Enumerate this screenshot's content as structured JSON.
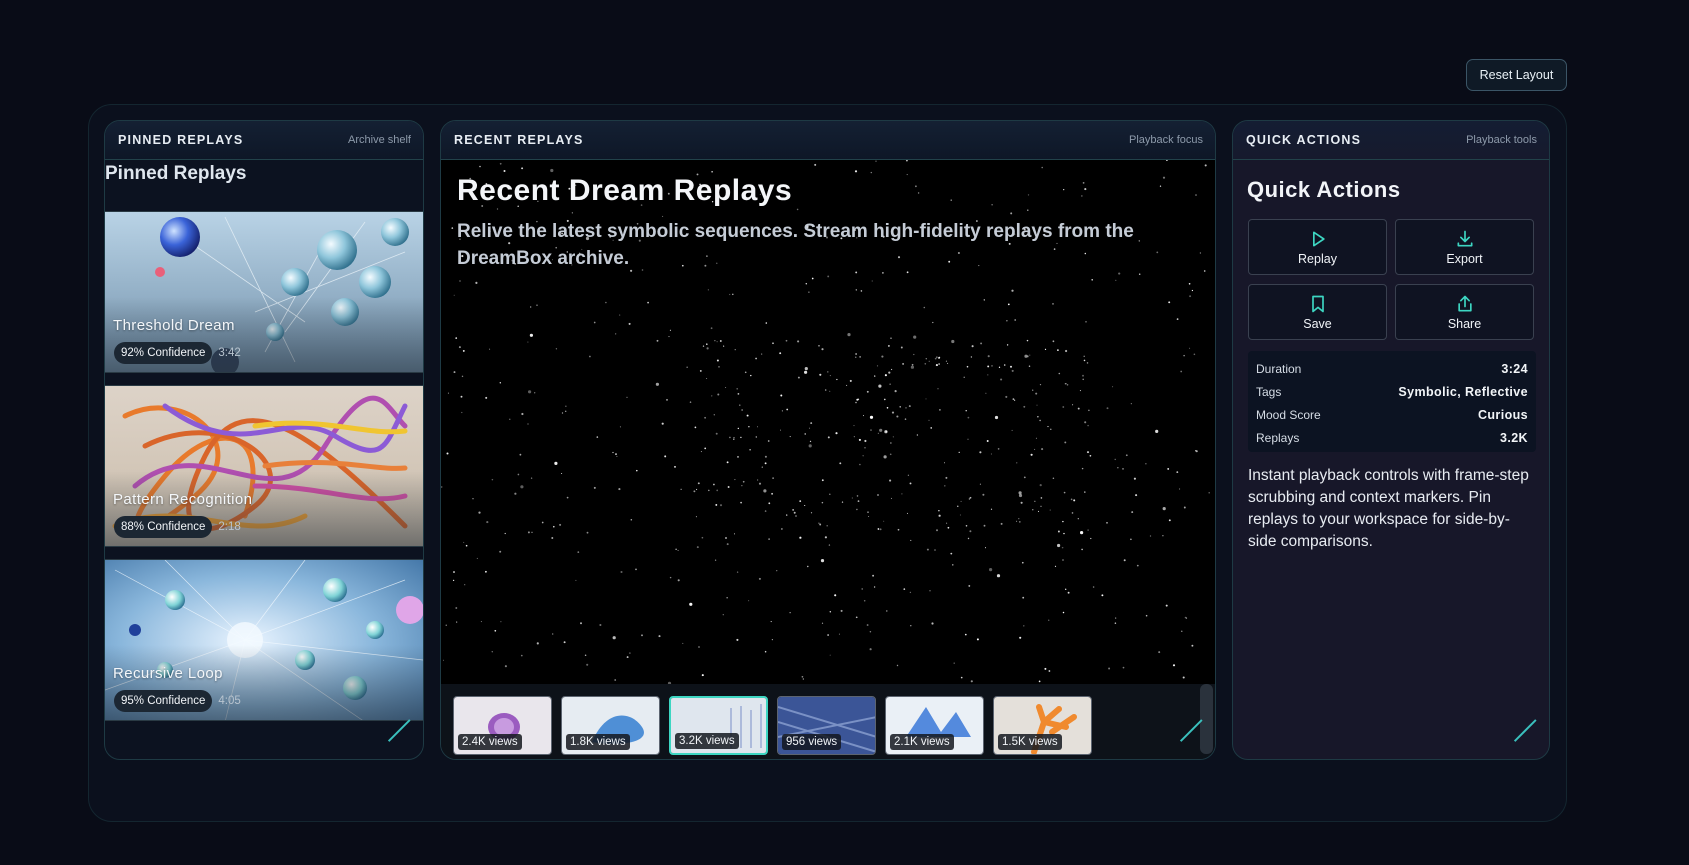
{
  "toolbar": {
    "reset_label": "Reset Layout"
  },
  "left": {
    "title": "PINNED REPLAYS",
    "subtitle": "Archive shelf",
    "heading": "Pinned Replays",
    "cards": [
      {
        "title": "Threshold Dream",
        "confidence": "92% Confidence",
        "duration": "3:42"
      },
      {
        "title": "Pattern Recognition",
        "confidence": "88% Confidence",
        "duration": "2:18"
      },
      {
        "title": "Recursive Loop",
        "confidence": "95% Confidence",
        "duration": "4:05"
      }
    ]
  },
  "center": {
    "title": "RECENT REPLAYS",
    "subtitle": "Playback focus",
    "viewer_title": "Recent Dream Replays",
    "viewer_desc": "Relive the latest symbolic sequences. Stream high-fidelity replays from the DreamBox archive.",
    "thumbnails": [
      {
        "views": "2.4K views"
      },
      {
        "views": "1.8K views"
      },
      {
        "views": "3.2K views"
      },
      {
        "views": "956 views"
      },
      {
        "views": "2.1K views"
      },
      {
        "views": "1.5K views"
      }
    ],
    "active_thumbnail_index": 2
  },
  "right": {
    "title": "QUICK ACTIONS",
    "subtitle": "Playback tools",
    "heading": "Quick Actions",
    "actions": [
      {
        "label": "Replay",
        "icon": "play-icon"
      },
      {
        "label": "Export",
        "icon": "download-icon"
      },
      {
        "label": "Save",
        "icon": "bookmark-icon"
      },
      {
        "label": "Share",
        "icon": "share-icon"
      }
    ],
    "stats": [
      {
        "key": "Duration",
        "value": "3:24"
      },
      {
        "key": "Tags",
        "value": "Symbolic, Reflective"
      },
      {
        "key": "Mood Score",
        "value": "Curious"
      },
      {
        "key": "Replays",
        "value": "3.2K"
      }
    ],
    "description": "Instant playback controls with frame-step scrubbing and context markers. Pin replays to your workspace for side-by-side comparisons."
  },
  "colors": {
    "accent": "#3dd6c2",
    "background": "#090c17"
  }
}
